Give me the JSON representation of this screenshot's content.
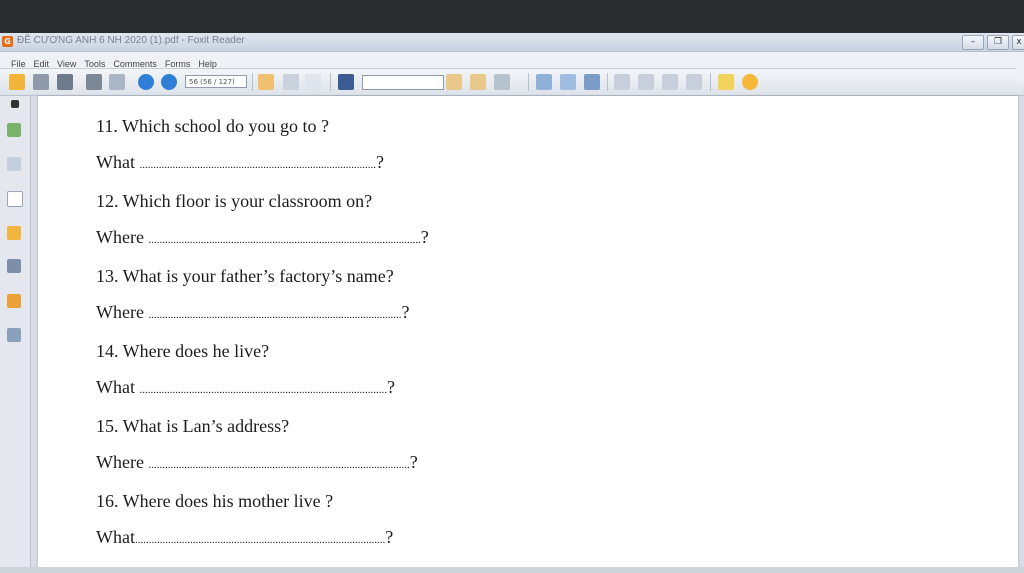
{
  "window": {
    "title": "ĐỀ CƯƠNG ANH 6 NH 2020 (1).pdf - Foxit Reader",
    "buttons": [
      "–",
      "❐",
      "x"
    ]
  },
  "menu": [
    "File",
    "Edit",
    "View",
    "Tools",
    "Comments",
    "Forms",
    "Help"
  ],
  "toolbar": {
    "page_indicator": "56 (56 / 127)",
    "icons": [
      "open-folder-icon",
      "save-icon",
      "save-as-icon",
      "print-icon",
      "email-icon",
      "previous-page-icon",
      "next-page-icon",
      "hand-tool-icon",
      "select-text-icon",
      "select-arrow-icon",
      "find-icon",
      "zoom-icon",
      "comment-icon"
    ]
  },
  "sidebar": {
    "icons": [
      "pages-icon",
      "bookmarks-icon",
      "layers-icon",
      "comments-icon",
      "attachments-icon",
      "security-icon",
      "edit-icon"
    ]
  },
  "document": {
    "lines": [
      {
        "text": "11. Which school do you go to ?"
      },
      {
        "text": "What ",
        "dots": "......................................................................................",
        "end": "?"
      },
      {
        "text": "12. Which floor is your classroom on?"
      },
      {
        "text": "Where ",
        "dots": "...................................................................................................",
        "end": "?"
      },
      {
        "text": "13. What is your father’s factory’s name?"
      },
      {
        "text": "Where ",
        "dots": "............................................................................................",
        "end": "?"
      },
      {
        "text": "14. Where does he live?"
      },
      {
        "text": "What ",
        "dots": "..........................................................................................",
        "end": "?"
      },
      {
        "text": "15. What is Lan’s address?"
      },
      {
        "text": "Where ",
        "dots": "...............................................................................................",
        "end": "?"
      },
      {
        "text": "16. Where does his mother live ?"
      },
      {
        "text": "What",
        "dots": "...........................................................................................",
        "end": "?"
      }
    ]
  },
  "colors": {
    "accent": "#e86b13",
    "page_background": "#ffffff",
    "chrome": "#d6dbe2"
  }
}
